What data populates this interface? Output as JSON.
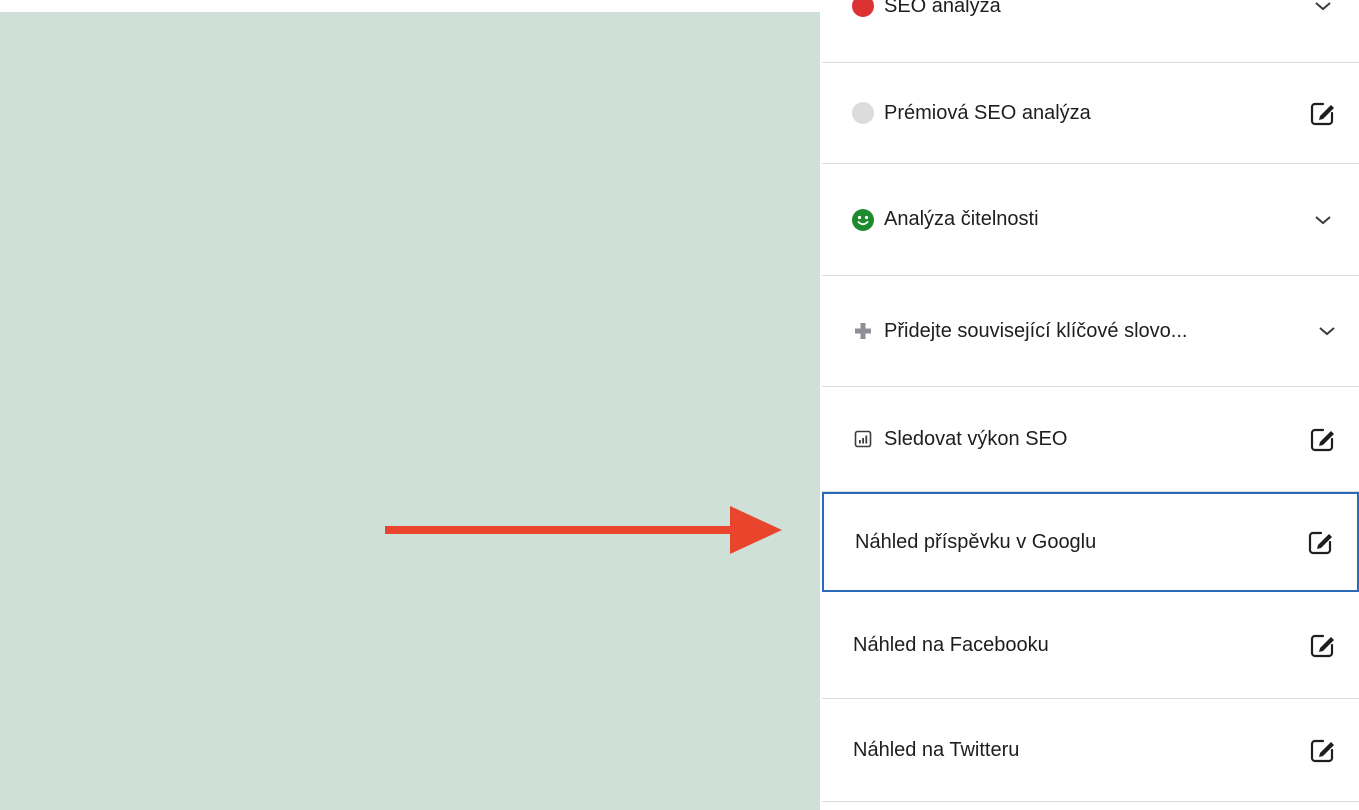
{
  "sidebar": {
    "rows": [
      {
        "label": "SEO analýza",
        "lead_icon": "red-dot-icon",
        "trail_icon": "chevron-down-icon"
      },
      {
        "label": "Prémiová SEO analýza",
        "lead_icon": "grey-dot-icon",
        "trail_icon": "edit-icon"
      },
      {
        "label": "Analýza čitelnosti",
        "lead_icon": "smiley-green-icon",
        "trail_icon": "chevron-down-icon"
      },
      {
        "label": "Přidejte související klíčové slovo...",
        "lead_icon": "plus-icon",
        "trail_icon": "chevron-down-icon"
      },
      {
        "label": "Sledovat výkon SEO",
        "lead_icon": "chart-icon",
        "trail_icon": "edit-icon"
      },
      {
        "label": "Náhled příspěvku v Googlu",
        "lead_icon": "",
        "trail_icon": "edit-icon"
      },
      {
        "label": "Náhled na Facebooku",
        "lead_icon": "",
        "trail_icon": "edit-icon"
      },
      {
        "label": "Náhled na Twitteru",
        "lead_icon": "",
        "trail_icon": "edit-icon"
      }
    ]
  },
  "colors": {
    "canvas_bg": "#cfe0d8",
    "arrow": "#e8452c",
    "status_red": "#dc3232",
    "status_green": "#1e8c2e",
    "focus_border": "#2a6ab8"
  }
}
